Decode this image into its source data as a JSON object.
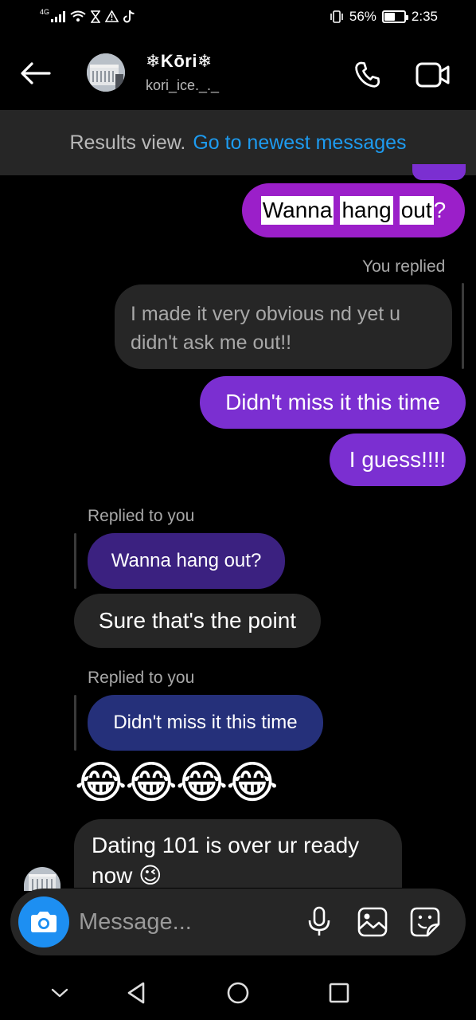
{
  "status_bar": {
    "network": "4G",
    "battery": "56%",
    "battery_level": 0.56,
    "time": "2:35"
  },
  "header": {
    "title": "❄Kōri❄",
    "username": "kori_ice._._"
  },
  "banner": {
    "prefix": "Results view.",
    "link": "Go to newest messages"
  },
  "messages": [
    {
      "words": [
        "Wanna",
        "hang",
        "out"
      ],
      "suffix": "?"
    },
    {
      "meta": "You replied",
      "text": "I made it very obvious nd yet u didn't ask me out!!"
    },
    {
      "text": "Didn't miss it this time"
    },
    {
      "text": "I guess!!!!"
    },
    {
      "meta": "Replied to you",
      "quote": "Wanna hang out?",
      "text": "Sure that's the point"
    },
    {
      "meta": "Replied to you",
      "quote": "Didn't miss it this time",
      "text": "😂😂😂😂"
    },
    {
      "text": "Dating 101 is over ur ready now 😉"
    }
  ],
  "composer": {
    "placeholder": "Message..."
  },
  "colors": {
    "sent_bubble": "#7b2fd1",
    "received_bubble": "#262626",
    "accent_blue": "#1d9bf0",
    "reply_quote_1": "#3b2180",
    "reply_quote_2": "#25307a"
  }
}
